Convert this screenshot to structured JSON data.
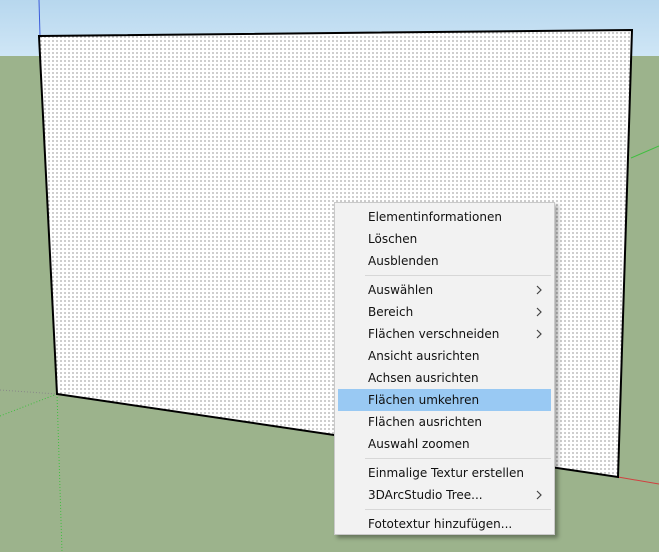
{
  "menu": {
    "group1": [
      {
        "label": "Elementinformationen",
        "submenu": false
      },
      {
        "label": "Löschen",
        "submenu": false
      },
      {
        "label": "Ausblenden",
        "submenu": false
      }
    ],
    "group2": [
      {
        "label": "Auswählen",
        "submenu": true
      },
      {
        "label": "Bereich",
        "submenu": true
      },
      {
        "label": "Flächen verschneiden",
        "submenu": true
      },
      {
        "label": "Ansicht ausrichten",
        "submenu": false
      },
      {
        "label": "Achsen ausrichten",
        "submenu": false
      },
      {
        "label": "Flächen umkehren",
        "submenu": false,
        "highlighted": true
      },
      {
        "label": "Flächen ausrichten",
        "submenu": false
      },
      {
        "label": "Auswahl zoomen",
        "submenu": false
      }
    ],
    "group3": [
      {
        "label": "Einmalige Textur erstellen",
        "submenu": false
      },
      {
        "label": "3DArcStudio Tree...",
        "submenu": true
      }
    ],
    "group4": [
      {
        "label": "Fototextur hinzufügen...",
        "submenu": false
      }
    ]
  },
  "colors": {
    "sky": "#c3dff2",
    "ground": "#9cb38c",
    "face": "#ffffff",
    "highlight": "#99c9f3",
    "axis_green": "#3fbf3f",
    "axis_red": "#d04040"
  }
}
